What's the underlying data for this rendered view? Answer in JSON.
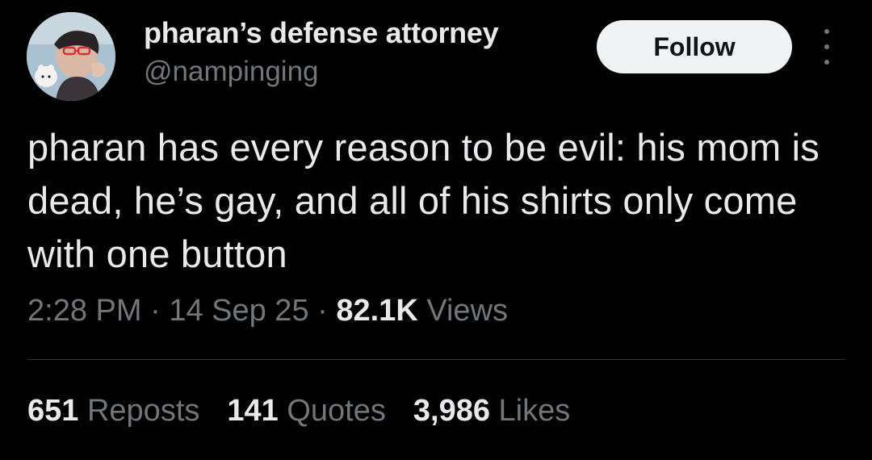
{
  "author": {
    "display_name": "pharan’s defense attorney",
    "handle": "@nampinging",
    "avatar_icon": "user-avatar-photo"
  },
  "actions": {
    "follow_label": "Follow",
    "more_icon": "more-vertical-icon"
  },
  "tweet": {
    "text": "pharan has every reason to be evil: his mom is dead, he’s gay, and all of his shirts only come with one button"
  },
  "meta": {
    "time": "2:28 PM",
    "separator": " · ",
    "date": "14 Sep 25",
    "views_count": "82.1K",
    "views_label": "Views"
  },
  "stats": {
    "reposts_count": "651",
    "reposts_label": "Reposts",
    "quotes_count": "141",
    "quotes_label": "Quotes",
    "likes_count": "3,986",
    "likes_label": "Likes"
  },
  "colors": {
    "background": "#000000",
    "primary_text": "#e7e9ea",
    "secondary_text": "#71767b",
    "divider": "#2f3336",
    "button_bg": "#eff3f4"
  }
}
